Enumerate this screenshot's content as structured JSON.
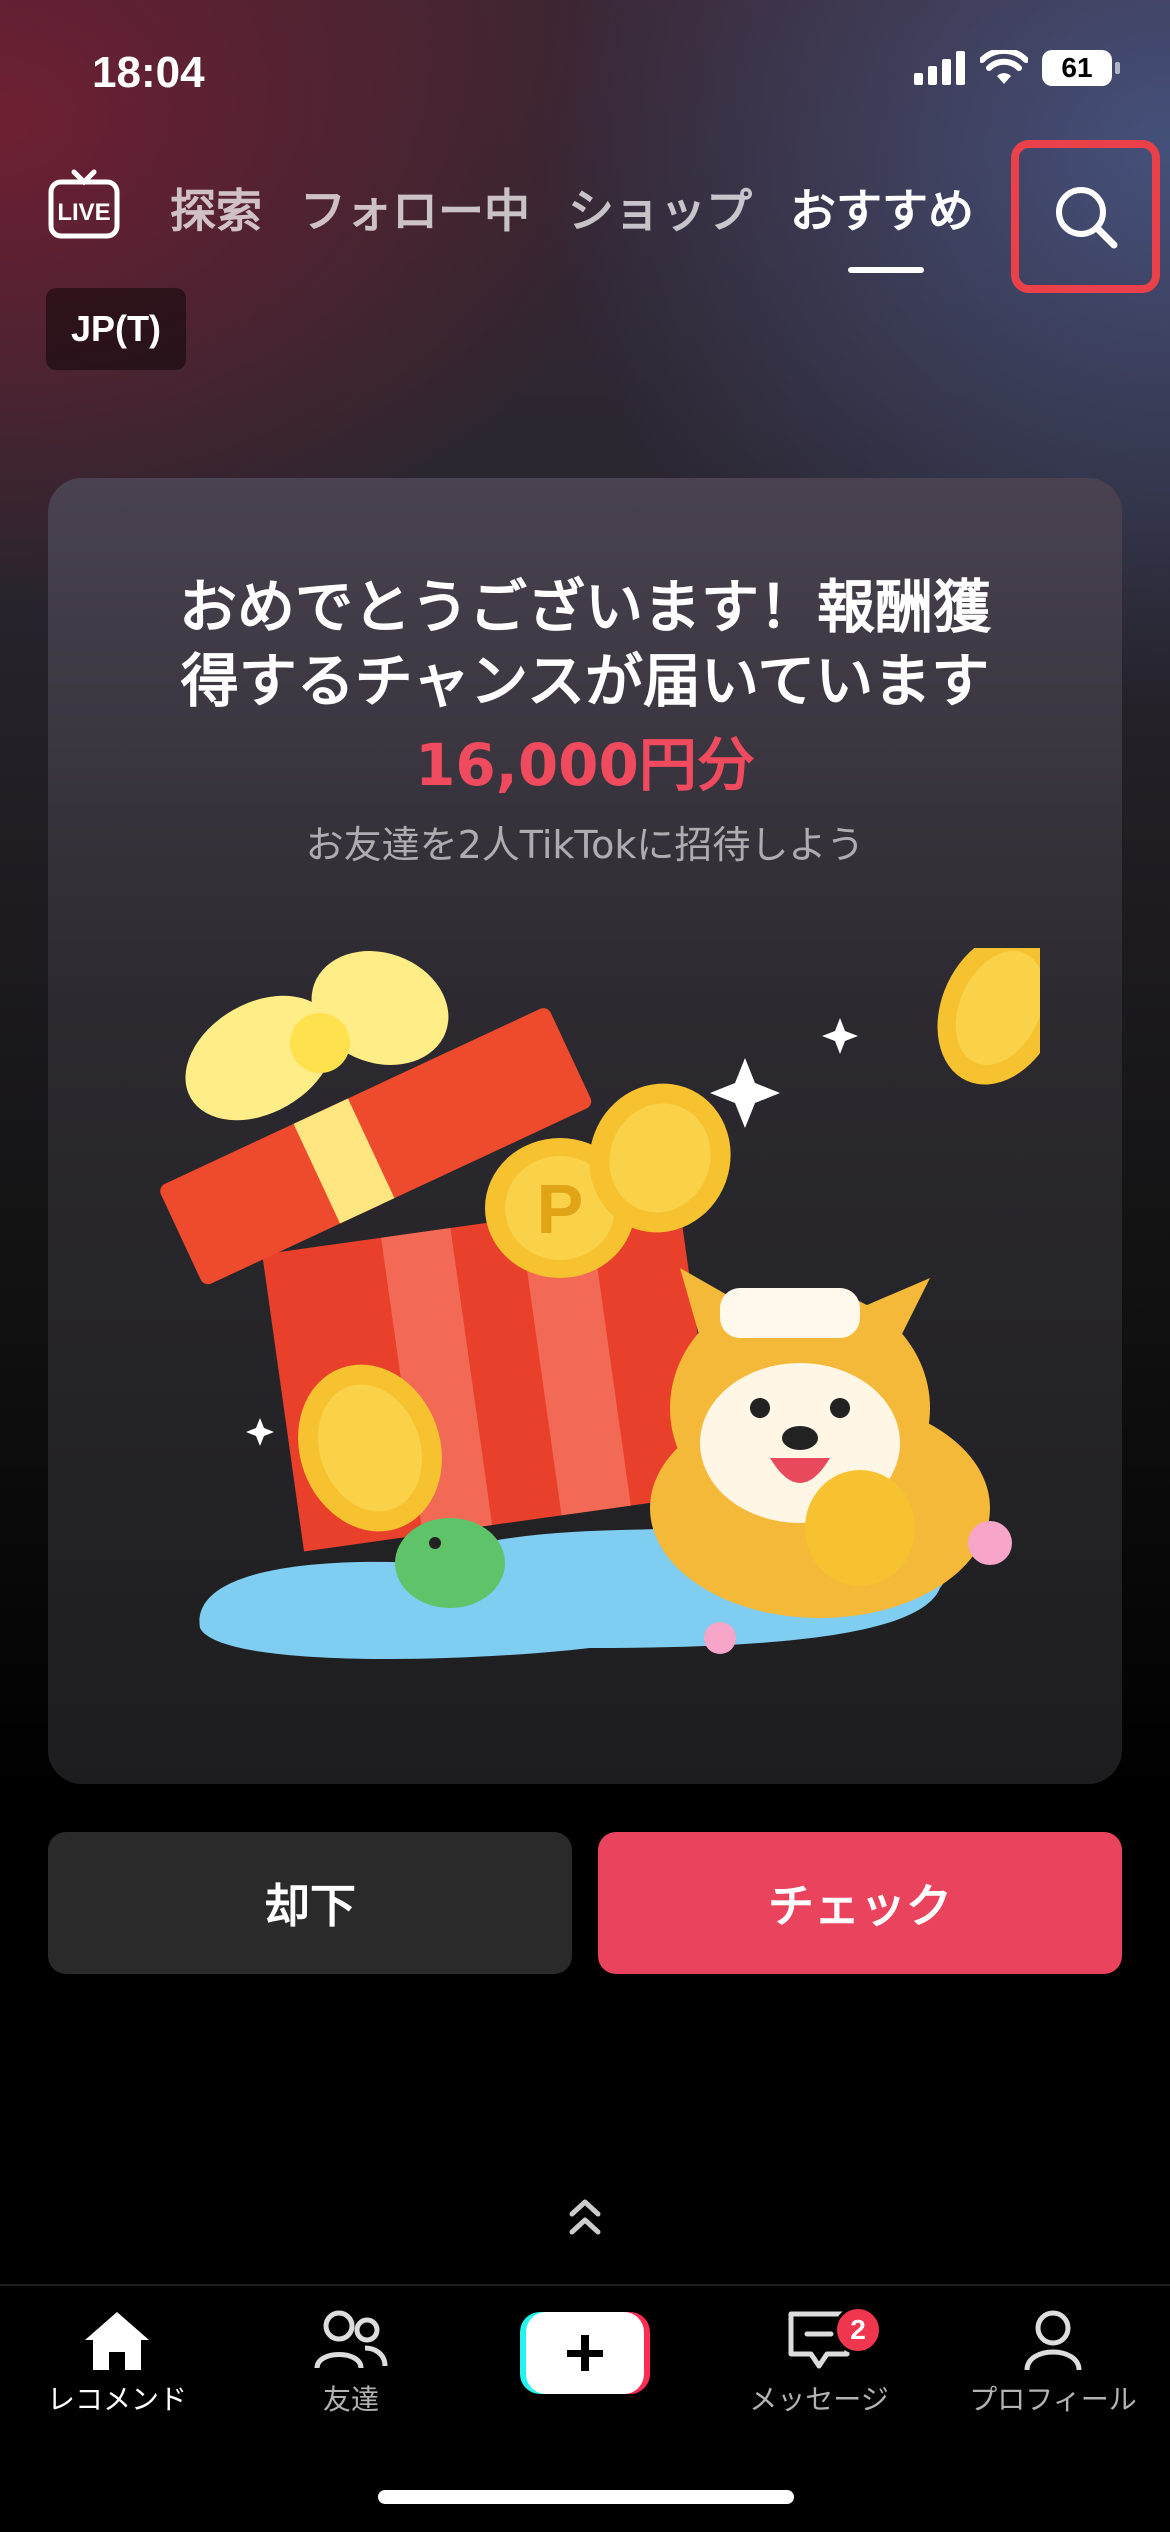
{
  "status_bar": {
    "time": "18:04",
    "battery": "61"
  },
  "top_nav": {
    "live_label": "LIVE",
    "tabs": [
      {
        "label": "探索"
      },
      {
        "label": "フォロー中"
      },
      {
        "label": "ショップ"
      },
      {
        "label": "おすすめ"
      }
    ],
    "active_tab": "おすすめ"
  },
  "region_badge": "JP(T)",
  "promo_card": {
    "title_line1": "おめでとうございます！報酬獲",
    "title_line2": "得するチャンスが届いています",
    "amount": "16,000円分",
    "subtitle": "お友達を2人TikTokに招待しよう",
    "coin_letter": "P"
  },
  "buttons": {
    "dismiss": "却下",
    "check": "チェック"
  },
  "bottom_nav": {
    "items": [
      {
        "label": "レコメンド"
      },
      {
        "label": "友達"
      },
      {
        "label": "メッセージ"
      },
      {
        "label": "プロフィール"
      }
    ],
    "message_badge": "2"
  },
  "colors": {
    "accent": "#e9435d",
    "highlight_box": "#e9404a",
    "amount": "#f04a5e"
  }
}
